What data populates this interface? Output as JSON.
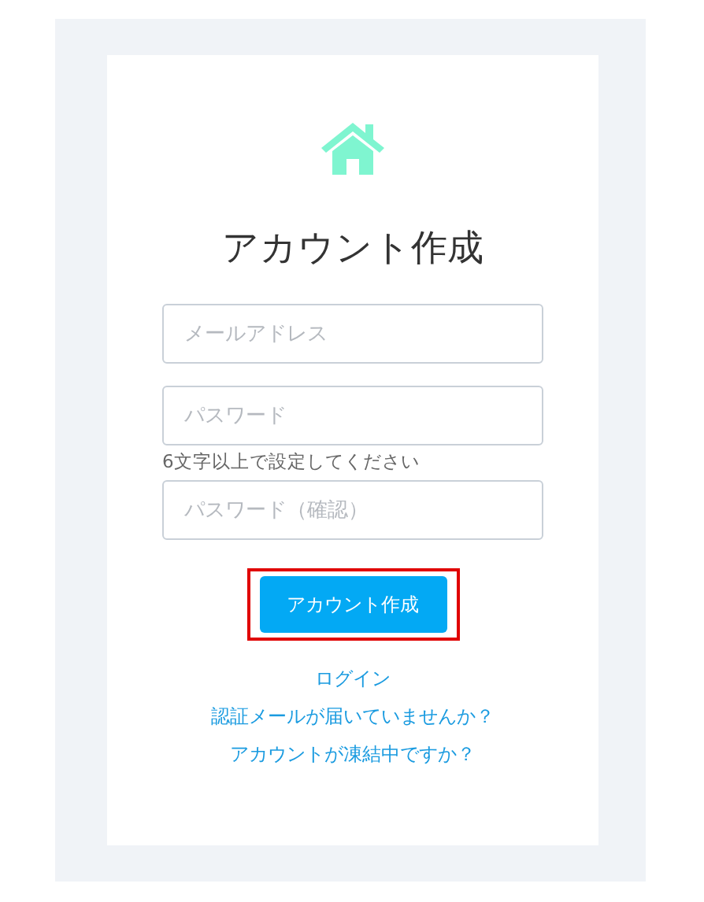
{
  "title": "アカウント作成",
  "fields": [
    {
      "placeholder": "メールアドレス"
    },
    {
      "placeholder": "パスワード",
      "hint": "6文字以上で設定してください"
    },
    {
      "placeholder": "パスワード（確認）"
    }
  ],
  "submit": {
    "label": "アカウント作成",
    "highlighted": true
  },
  "links": [
    "ログイン",
    "認証メールが届いていませんか？",
    "アカウントが凍結中ですか？"
  ]
}
